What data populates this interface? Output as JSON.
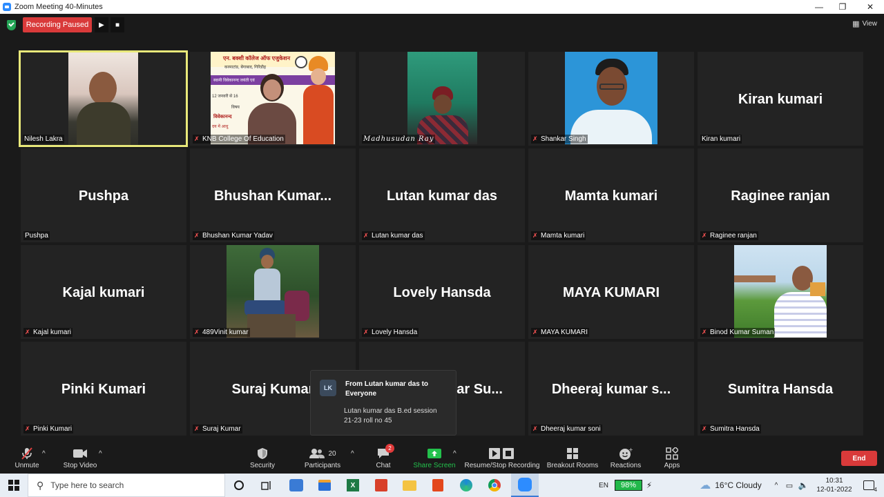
{
  "window": {
    "title": "Zoom Meeting 40-Minutes"
  },
  "topbar": {
    "recording_label": "Recording Paused",
    "view_label": "View"
  },
  "grid": {
    "tiles": [
      {
        "big": "",
        "label": "Nilesh Lakra"
      },
      {
        "big": "",
        "label": "KNB College Of Education"
      },
      {
        "big": "",
        "label": "Madhusudan Ray"
      },
      {
        "big": "",
        "label": "Shankar Singh"
      },
      {
        "big": "Kiran kumari",
        "label": "Kiran kumari"
      },
      {
        "big": "Pushpa",
        "label": "Pushpa"
      },
      {
        "big": "Bhushan  Kumar...",
        "label": "Bhushan Kumar Yadav"
      },
      {
        "big": "Lutan kumar das",
        "label": "Lutan kumar das"
      },
      {
        "big": "Mamta kumari",
        "label": "Mamta kumari"
      },
      {
        "big": "Raginee ranjan",
        "label": "Raginee ranjan"
      },
      {
        "big": "Kajal kumari",
        "label": "Kajal kumari"
      },
      {
        "big": "",
        "label": "489Vinit kumar"
      },
      {
        "big": "Lovely Hansda",
        "label": "Lovely Hansda"
      },
      {
        "big": "MAYA KUMARI",
        "label": "MAYA KUMARI"
      },
      {
        "big": "",
        "label": "Binod Kumar Suman"
      },
      {
        "big": "Pinki Kumari",
        "label": "Pinki Kumari"
      },
      {
        "big": "Suraj Kumar",
        "label": "Suraj Kumar"
      },
      {
        "big": "ar Su...",
        "label": ""
      },
      {
        "big": "Dheeraj  kumar  s...",
        "label": "Dheeraj kumar soni"
      },
      {
        "big": "Sumitra Hansda",
        "label": "Sumitra Hansda"
      }
    ],
    "banner_line1": "एन. बक्शी कॉलेज ऑफ एजुकेशन",
    "banner_line2": "करमाटांड, बेंगाबाद, गिरिडीह",
    "banner_line3": "स्वामी विवेकानन्द जयंती एवं",
    "banner_line4": "12 जनवरी से 16",
    "banner_line5": "विषय",
    "banner_line6": "विवेकानन्द",
    "banner_line7": "दय में आधु"
  },
  "chat_popup": {
    "avatar": "LK",
    "from": "From Lutan kumar das to Everyone",
    "message": "Lutan kumar das B.ed session 21-23  roll no 45"
  },
  "toolbar": {
    "unmute": "Unmute",
    "stop_video": "Stop Video",
    "security": "Security",
    "participants": "Participants",
    "participants_count": "20",
    "chat": "Chat",
    "chat_badge": "2",
    "share_screen": "Share Screen",
    "recording": "Resume/Stop Recording",
    "breakout": "Breakout Rooms",
    "reactions": "Reactions",
    "apps": "Apps",
    "end": "End",
    "colors": {
      "share_green": "#23c14c",
      "end_red": "#d93a3a"
    }
  },
  "taskbar": {
    "search_placeholder": "Type here to search",
    "lang": "EN",
    "battery": "98%",
    "weather": "16°C  Cloudy",
    "time": "10:31",
    "date": "12-01-2022",
    "notif_count": "4"
  }
}
